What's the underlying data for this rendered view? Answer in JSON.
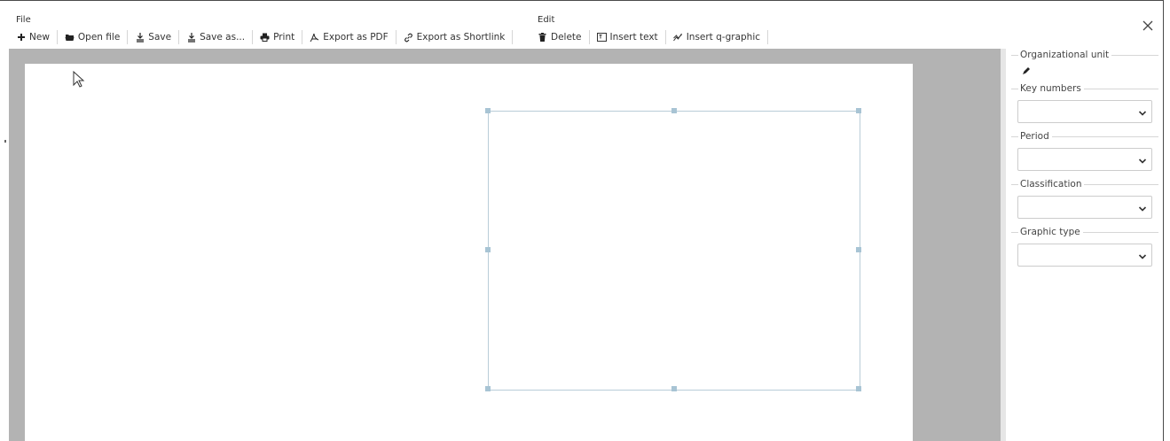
{
  "menu": {
    "file_group_label": "File",
    "edit_group_label": "Edit",
    "file_actions": [
      {
        "label": "New",
        "icon": "plus-icon"
      },
      {
        "label": "Open file",
        "icon": "folder-open-icon"
      },
      {
        "label": "Save",
        "icon": "save-icon"
      },
      {
        "label": "Save as...",
        "icon": "save-as-icon"
      },
      {
        "label": "Print",
        "icon": "print-icon"
      },
      {
        "label": "Export as PDF",
        "icon": "pdf-icon"
      },
      {
        "label": "Export as Shortlink",
        "icon": "link-icon"
      }
    ],
    "edit_actions": [
      {
        "label": "Delete",
        "icon": "trash-icon"
      },
      {
        "label": "Insert text",
        "icon": "text-box-icon"
      },
      {
        "label": "Insert q-graphic",
        "icon": "line-chart-icon"
      }
    ]
  },
  "panel": {
    "org_unit_label": "Organizational unit",
    "key_numbers_label": "Key numbers",
    "period_label": "Period",
    "classification_label": "Classification",
    "graphic_type_label": "Graphic type",
    "key_numbers_value": "",
    "period_value": "",
    "classification_value": "",
    "graphic_type_value": ""
  },
  "colors": {
    "workspace_bg": "#b3b3b3",
    "selection_border": "#b9cdd8",
    "handle": "#a8c4d4"
  }
}
